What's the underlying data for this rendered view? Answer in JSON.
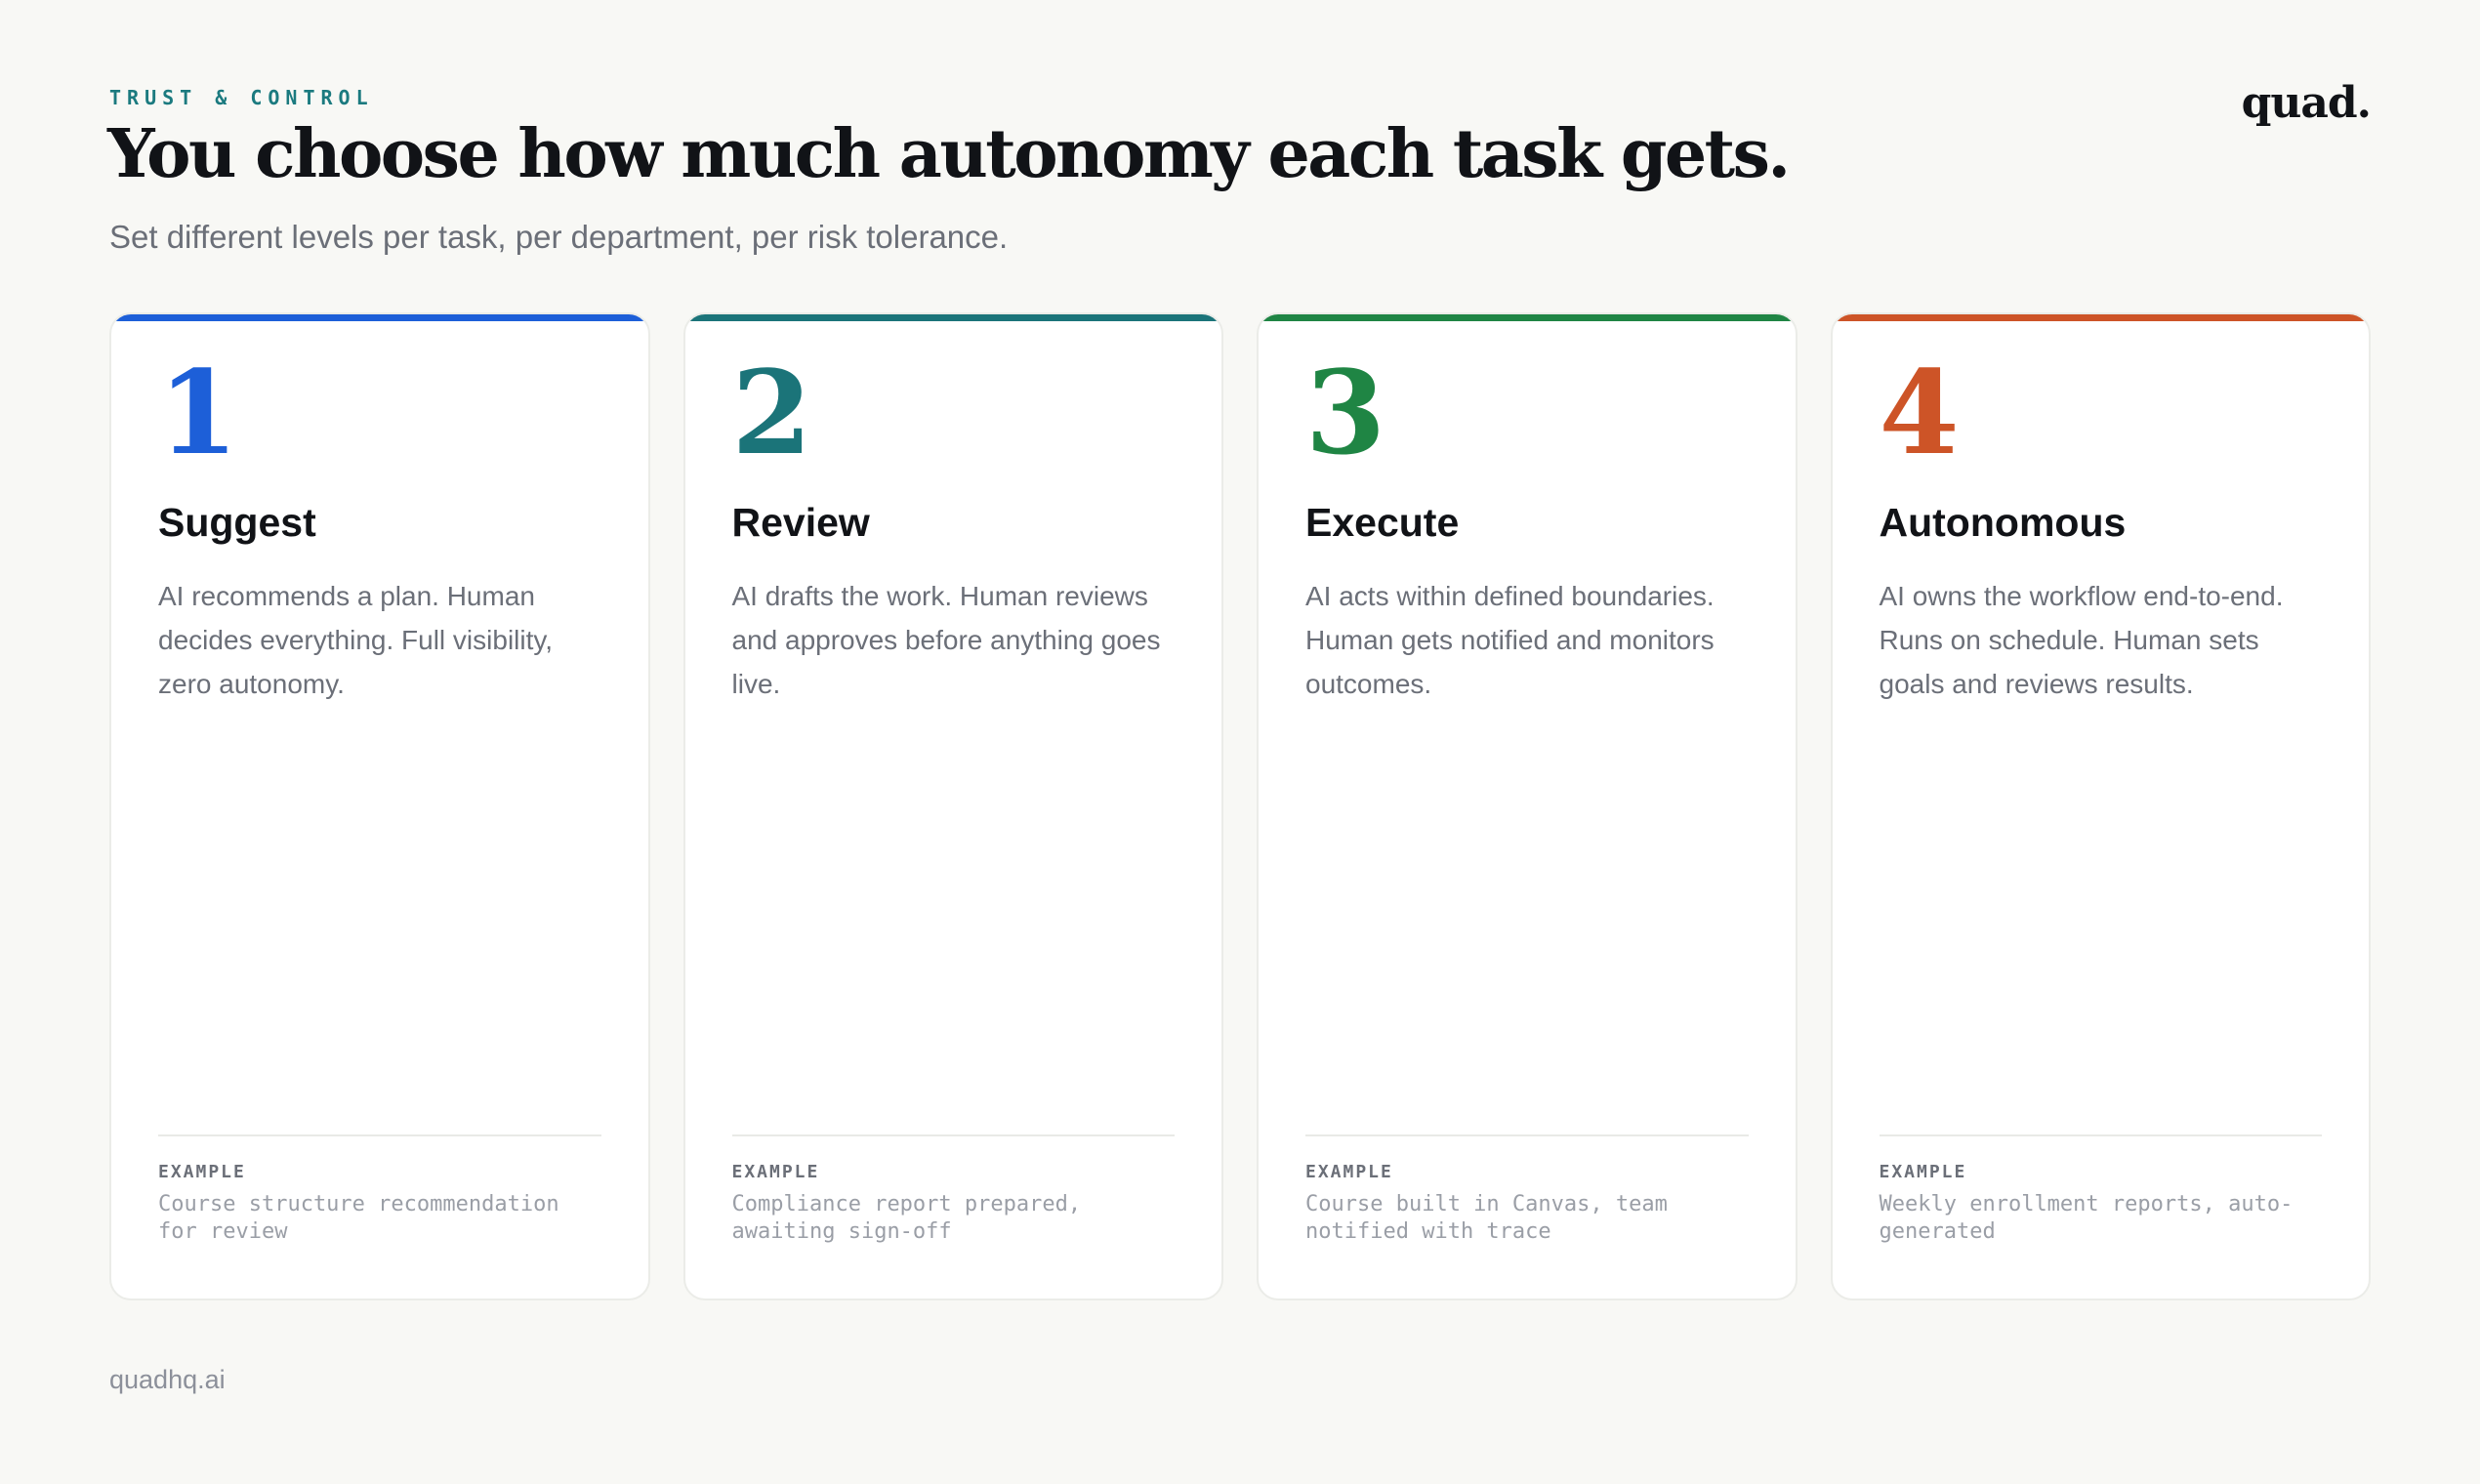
{
  "header": {
    "eyebrow": "TRUST & CONTROL",
    "title": "You choose how much autonomy each task gets.",
    "subtitle": "Set different levels per task, per department, per risk tolerance.",
    "logo": "quad."
  },
  "cards": [
    {
      "number": "1",
      "title": "Suggest",
      "description": "AI recommends a plan. Human decides everything. Full visibility, zero autonomy.",
      "example_label": "EXAMPLE",
      "example": "Course structure recommendation for review",
      "color": "#1d5fd8"
    },
    {
      "number": "2",
      "title": "Review",
      "description": "AI drafts the work. Human reviews and approves before anything goes live.",
      "example_label": "EXAMPLE",
      "example": "Compliance report prepared, awaiting sign-off",
      "color": "#1b7479"
    },
    {
      "number": "3",
      "title": "Execute",
      "description": "AI acts within defined boundaries. Human gets notified and monitors outcomes.",
      "example_label": "EXAMPLE",
      "example": "Course built in Canvas, team notified with trace",
      "color": "#1f8544"
    },
    {
      "number": "4",
      "title": "Autonomous",
      "description": "AI owns the workflow end-to-end. Runs on schedule. Human sets goals and reviews results.",
      "example_label": "EXAMPLE",
      "example": "Weekly enrollment reports, auto-generated",
      "color": "#cd5427"
    }
  ],
  "footer": {
    "site": "quadhq.ai"
  }
}
